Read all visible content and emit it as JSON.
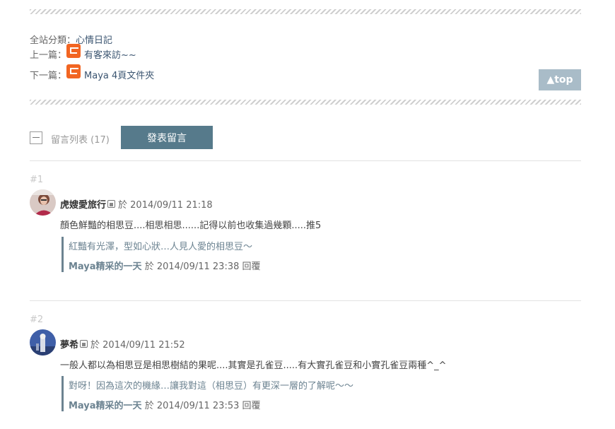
{
  "nav": {
    "category_label": "全站分類：",
    "category_value": "心情日記",
    "prev_label": "上一篇：",
    "prev_title": "有客來訪~~",
    "next_label": "下一篇：",
    "next_title": "Maya 4頁文件夾",
    "top_label": "▲top"
  },
  "comments_header": {
    "title": "留言列表",
    "count": "(17)",
    "post_button": "發表留言"
  },
  "comments": [
    {
      "number": "#1",
      "author": "虎嫂愛旅行",
      "time": "於 2014/09/11 21:18",
      "text": "顏色鮮豔的相思豆....相思相思......記得以前也收集過幾顆.....推5",
      "reply_text": "紅豔有光澤，型如心狀…人見人愛的相思豆～",
      "reply_author": "Maya精采的一天",
      "reply_time": "於 2014/09/11 23:38 回覆"
    },
    {
      "number": "#2",
      "author": "夢希",
      "time": "於 2014/09/11 21:52",
      "text": "一般人都以為相思豆是相思樹結的果呢....其實是孔雀豆.....有大實孔雀豆和小實孔雀豆兩種^_^",
      "reply_text": "對呀！因為這次的機緣…讓我對這（相思豆）有更深一層的了解呢～～",
      "reply_author": "Maya精采的一天",
      "reply_time": "於 2014/09/11 23:53 回覆"
    }
  ],
  "colors": {
    "accent": "#567a8b",
    "top_button": "#a9bcc8",
    "reply_bar": "#6c8391",
    "icon_orange": "#f26522"
  }
}
